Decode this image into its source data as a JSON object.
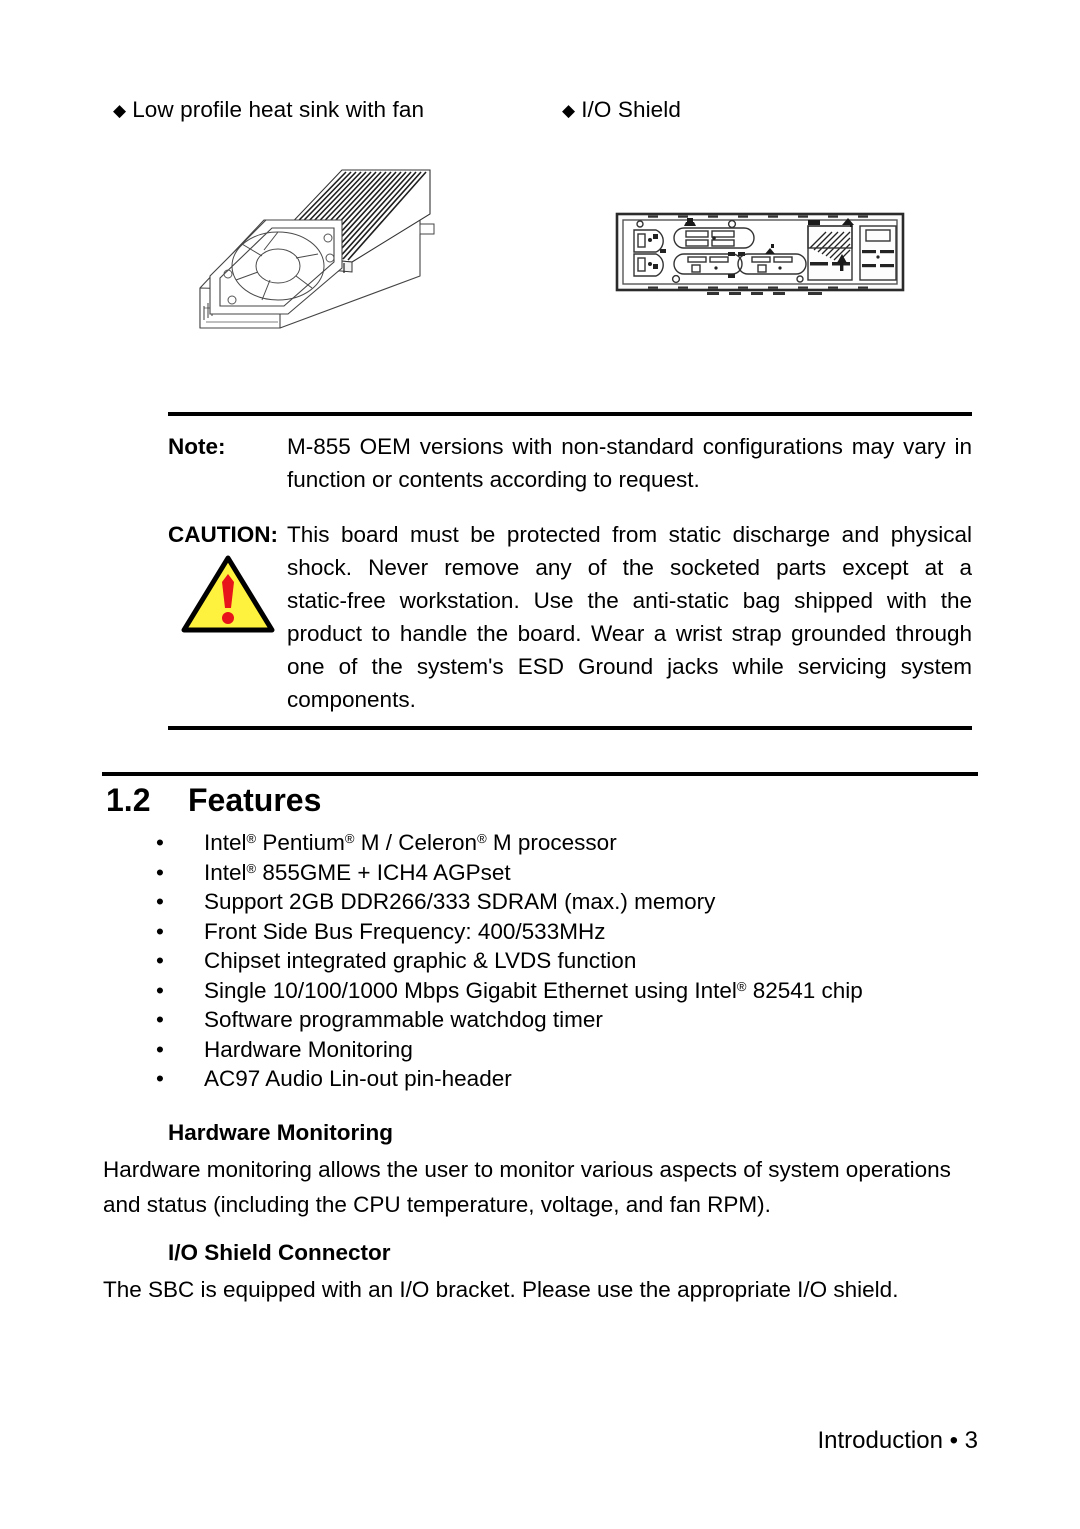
{
  "page": {
    "footer": "Introduction • 3"
  },
  "figures": {
    "heatsink": {
      "caption_bullet": "◆",
      "caption": "Low profile heat sink with fan",
      "icon": "heat-sink-with-fan-illustration"
    },
    "ioshield": {
      "caption_bullet": "◆",
      "caption": "I/O Shield",
      "icon": "io-shield-bracket-illustration"
    }
  },
  "callout": {
    "note": {
      "label": "Note:",
      "text": "M-855 OEM versions with non-standard configurations may vary in function or contents according to request.",
      "line1": "M-855 OEM versions with non-standard configurations may vary",
      "line2": "in function or contents according to request."
    },
    "caution": {
      "label": "CAUTION:",
      "icon": "warning-triangle-icon",
      "text": "This board must be protected from static discharge and physical shock. Never remove any of the socketed parts except at a static-free workstation. Use the anti-static bag shipped with the product to handle the board. Wear a wrist strap grounded through one of the system's ESD Ground jacks while servicing system components.",
      "line1": "This board must be protected from static discharge and physical",
      "line2": "shock. Never remove any of the socketed parts except at a",
      "line3": "static-free workstation. Use the anti-static bag shipped with the",
      "line4": "product to handle the board. Wear a wrist strap grounded through",
      "line5": "one of the system's ESD Ground jacks while servicing system",
      "line6": "components."
    },
    "colors": {
      "triangle_fill": "#FFF23F",
      "triangle_stroke": "#000000",
      "exclamation": "#E8141B"
    }
  },
  "section": {
    "number": "1.2",
    "title": "Features",
    "bullet": "•",
    "features": [
      {
        "parts": [
          {
            "t": "Intel"
          },
          {
            "r": "®"
          },
          {
            "t": " Pentium"
          },
          {
            "r": "®"
          },
          {
            "t": " M / Celeron"
          },
          {
            "r": "®"
          },
          {
            "t": " M processor"
          }
        ],
        "plain": "Intel® Pentium® M / Celeron® M processor"
      },
      {
        "parts": [
          {
            "t": "Intel"
          },
          {
            "r": "®"
          },
          {
            "t": " 855GME + ICH4 AGPset"
          }
        ],
        "plain": "Intel® 855GME + ICH4 AGPset"
      },
      {
        "parts": [
          {
            "t": "Support 2GB DDR266/333 SDRAM (max.) memory"
          }
        ],
        "plain": "Support 2GB DDR266/333 SDRAM (max.) memory"
      },
      {
        "parts": [
          {
            "t": "Front Side Bus Frequency: 400/533MHz"
          }
        ],
        "plain": "Front Side Bus Frequency: 400/533MHz"
      },
      {
        "parts": [
          {
            "t": "Chipset integrated graphic & LVDS function"
          }
        ],
        "plain": "Chipset integrated graphic & LVDS function"
      },
      {
        "parts": [
          {
            "t": "Single 10/100/1000 Mbps Gigabit Ethernet using Intel"
          },
          {
            "r": "®"
          },
          {
            "t": " 82541 chip"
          }
        ],
        "plain": "Single 10/100/1000 Mbps Gigabit Ethernet using Intel® 82541 chip"
      },
      {
        "parts": [
          {
            "t": "Software programmable watchdog timer"
          }
        ],
        "plain": "Software programmable watchdog timer"
      },
      {
        "parts": [
          {
            "t": "Hardware Monitoring"
          }
        ],
        "plain": "Hardware Monitoring"
      },
      {
        "parts": [
          {
            "t": "AC97 Audio Lin-out pin-header"
          }
        ],
        "plain": "AC97 Audio Lin-out pin-header"
      }
    ]
  },
  "subsections": {
    "hardware_monitoring": {
      "heading": "Hardware Monitoring",
      "line1": "Hardware monitoring allows the user to monitor various aspects of system operations",
      "line2": "and status (including the CPU temperature, voltage, and fan RPM)."
    },
    "io_shield_connector": {
      "heading": "I/O Shield Connector",
      "line1": "The SBC is equipped with an I/O bracket. Please use the appropriate I/O shield."
    }
  }
}
